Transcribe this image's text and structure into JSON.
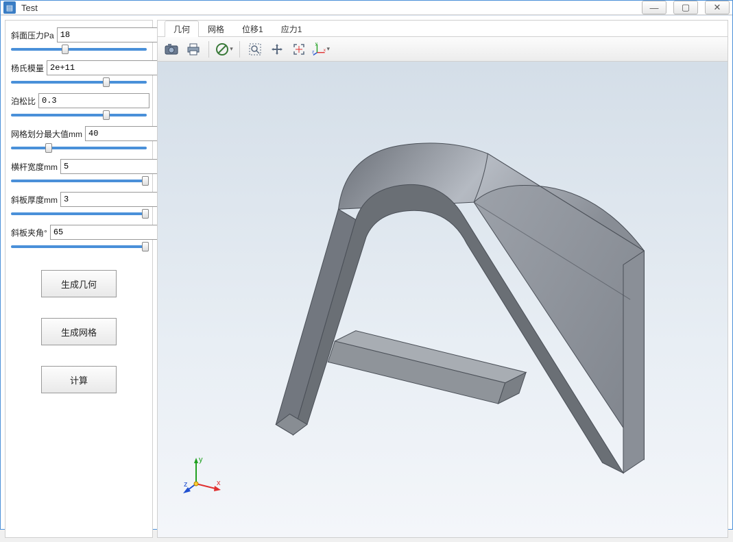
{
  "window": {
    "title": "Test"
  },
  "params": [
    {
      "key": "pressure",
      "label": "斜面压力Pa",
      "value": "18",
      "thumb_pct": 40
    },
    {
      "key": "youngs",
      "label": "杨氏模量",
      "value": "2e+11",
      "thumb_pct": 70
    },
    {
      "key": "poisson",
      "label": "泊松比",
      "value": "0.3",
      "thumb_pct": 70
    },
    {
      "key": "meshmax",
      "label": "网格划分最大值mm",
      "value": "40",
      "thumb_pct": 28
    },
    {
      "key": "barwidth",
      "label": "横杆宽度mm",
      "value": "5",
      "thumb_pct": 99
    },
    {
      "key": "thickness",
      "label": "斜板厚度mm",
      "value": "3",
      "thumb_pct": 99
    },
    {
      "key": "angle",
      "label": "斜板夹角°",
      "value": "65",
      "thumb_pct": 99
    }
  ],
  "actions": {
    "gen_geom": "生成几何",
    "gen_mesh": "生成网格",
    "compute": "计算"
  },
  "tabs": {
    "geom": "几何",
    "mesh": "网格",
    "disp1": "位移1",
    "stress1": "应力1",
    "active": "几何"
  },
  "toolbar_icons": {
    "camera": "camera-icon",
    "print": "print-icon",
    "nosel": "no-select-icon",
    "zoomrect": "zoom-rect-icon",
    "pan": "pan-icon",
    "fit": "fit-view-icon",
    "axes": "axes-icon"
  },
  "gizmo_labels": {
    "x": "x",
    "y": "y",
    "z": "z"
  },
  "colors": {
    "accent": "#4a90d9",
    "axis_x": "#e03030",
    "axis_y": "#20a020",
    "axis_z": "#2050d0"
  }
}
